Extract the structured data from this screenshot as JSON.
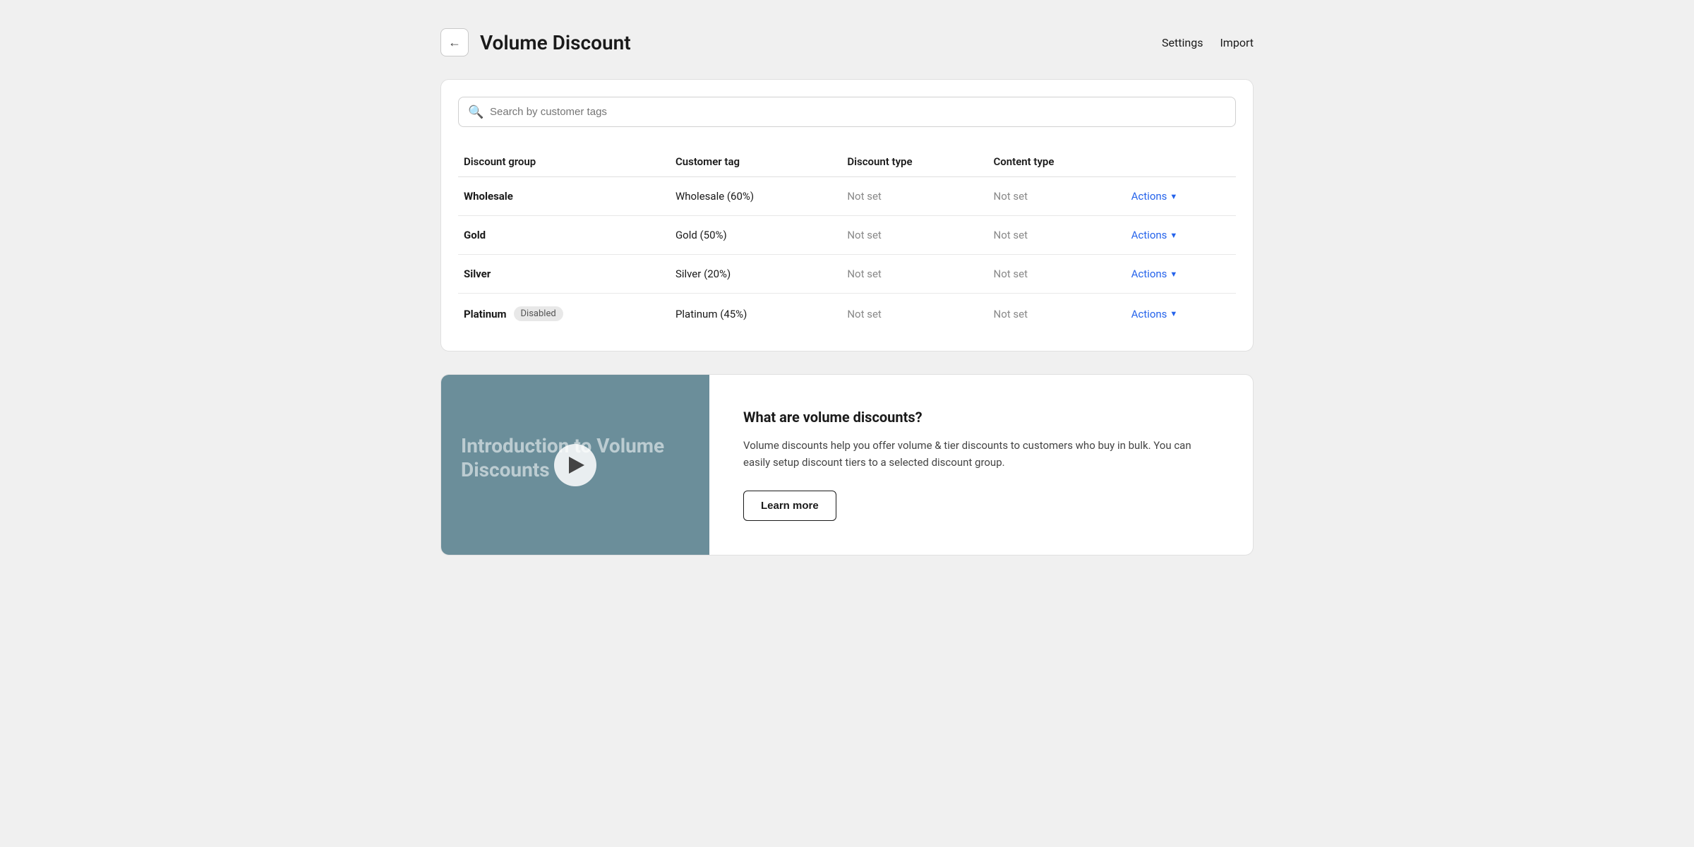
{
  "header": {
    "title": "Volume Discount",
    "back_label": "←",
    "settings_label": "Settings",
    "import_label": "Import"
  },
  "search": {
    "placeholder": "Search by customer tags"
  },
  "table": {
    "columns": [
      "Discount group",
      "Customer tag",
      "Discount type",
      "Content type"
    ],
    "rows": [
      {
        "group": "Wholesale",
        "badge": null,
        "customer_tag": "Wholesale (60%)",
        "discount_type": "Not set",
        "content_type": "Not set",
        "actions_label": "Actions"
      },
      {
        "group": "Gold",
        "badge": null,
        "customer_tag": "Gold (50%)",
        "discount_type": "Not set",
        "content_type": "Not set",
        "actions_label": "Actions"
      },
      {
        "group": "Silver",
        "badge": null,
        "customer_tag": "Silver (20%)",
        "discount_type": "Not set",
        "content_type": "Not set",
        "actions_label": "Actions"
      },
      {
        "group": "Platinum",
        "badge": "Disabled",
        "customer_tag": "Platinum (45%)",
        "discount_type": "Not set",
        "content_type": "Not set",
        "actions_label": "Actions"
      }
    ]
  },
  "info_card": {
    "video_text": "Introduction to Volume Discounts",
    "play_label": "▶",
    "title": "What are volume discounts?",
    "description": "Volume discounts help you offer volume & tier discounts to customers who buy in bulk. You can easily setup discount tiers to a selected discount group.",
    "learn_more_label": "Learn more"
  }
}
